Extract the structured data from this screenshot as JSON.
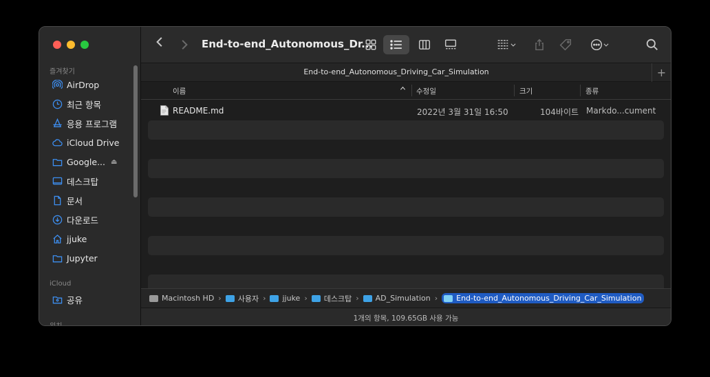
{
  "sidebar": {
    "favorites_label": "즐겨찾기",
    "favorites": [
      {
        "label": "AirDrop",
        "icon": "airdrop-icon"
      },
      {
        "label": "최근 항목",
        "icon": "clock-icon"
      },
      {
        "label": "응용 프로그램",
        "icon": "applications-icon"
      },
      {
        "label": "iCloud Drive",
        "icon": "cloud-icon"
      },
      {
        "label": "Google...",
        "icon": "folder-icon",
        "eject": "⏏"
      },
      {
        "label": "데스크탑",
        "icon": "desktop-icon"
      },
      {
        "label": "문서",
        "icon": "document-icon"
      },
      {
        "label": "다운로드",
        "icon": "download-icon"
      },
      {
        "label": "jjuke",
        "icon": "home-icon"
      },
      {
        "label": "Jupyter",
        "icon": "folder-icon"
      }
    ],
    "icloud_label": "iCloud",
    "icloud": [
      {
        "label": "공유",
        "icon": "shared-folder-icon"
      }
    ],
    "locations_label": "위치"
  },
  "toolbar": {
    "title": "End-to-end_Autonomous_Dr...",
    "back": "‹",
    "forward": "›"
  },
  "tab": {
    "title": "End-to-end_Autonomous_Driving_Car_Simulation",
    "add": "+"
  },
  "columns": {
    "name": "이름",
    "date": "수정일",
    "size": "크기",
    "kind": "종류"
  },
  "files": [
    {
      "name": "README.md",
      "date": "2022년 3월 31일 16:50",
      "size": "104바이트",
      "kind": "Markdo...cument"
    }
  ],
  "pathbar": [
    {
      "label": "Macintosh HD",
      "type": "disk"
    },
    {
      "label": "사용자",
      "type": "folder"
    },
    {
      "label": "jjuke",
      "type": "folder"
    },
    {
      "label": "데스크탑",
      "type": "folder"
    },
    {
      "label": "AD_Simulation",
      "type": "folder"
    },
    {
      "label": "End-to-end_Autonomous_Driving_Car_Simulation",
      "type": "folder-current"
    }
  ],
  "path_separator": "›",
  "status": "1개의 항목, 109.65GB 사용 가능",
  "colors": {
    "accent": "#1f5bc2",
    "sidebar_icon": "#3d8ef0",
    "folder": "#3ea2e6"
  }
}
